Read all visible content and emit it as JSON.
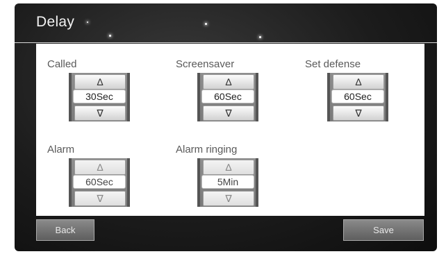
{
  "title": "Delay",
  "settings": [
    {
      "label": "Called",
      "value": "30Sec"
    },
    {
      "label": "Screensaver",
      "value": "60Sec"
    },
    {
      "label": "Set defense",
      "value": "60Sec"
    },
    {
      "label": "Alarm",
      "value": "60Sec"
    },
    {
      "label": "Alarm ringing",
      "value": "5Min"
    }
  ],
  "buttons": {
    "back": "Back",
    "save": "Save"
  },
  "icons": {
    "up": "chevron-up-icon",
    "down": "chevron-down-icon"
  }
}
